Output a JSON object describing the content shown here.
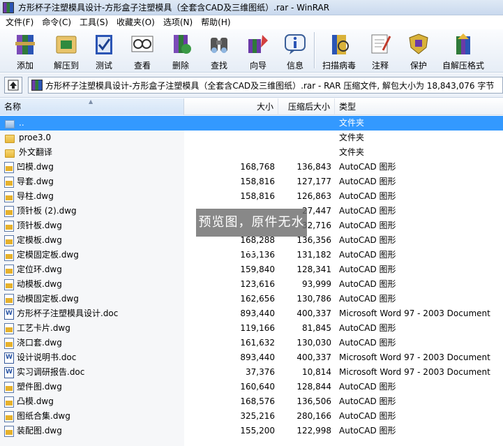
{
  "window": {
    "title": "方形杯子注塑模具设计-方形盒子注塑模具（全套含CAD及三维图纸）.rar - WinRAR"
  },
  "menu": [
    "文件(F)",
    "命令(C)",
    "工具(S)",
    "收藏夹(O)",
    "选项(N)",
    "帮助(H)"
  ],
  "toolbar": [
    {
      "label": "添加",
      "icon": "add-archive-icon"
    },
    {
      "label": "解压到",
      "icon": "extract-to-icon"
    },
    {
      "label": "测试",
      "icon": "test-icon"
    },
    {
      "label": "查看",
      "icon": "view-icon"
    },
    {
      "label": "删除",
      "icon": "delete-icon"
    },
    {
      "label": "查找",
      "icon": "find-icon"
    },
    {
      "label": "向导",
      "icon": "wizard-icon"
    },
    {
      "label": "信息",
      "icon": "info-icon"
    },
    {
      "label": "扫描病毒",
      "icon": "virus-scan-icon"
    },
    {
      "label": "注释",
      "icon": "comment-icon"
    },
    {
      "label": "保护",
      "icon": "protect-icon"
    },
    {
      "label": "自解压格式",
      "icon": "sfx-icon"
    }
  ],
  "address": {
    "path": "方形杯子注塑模具设计-方形盒子注塑模具（全套含CAD及三维图纸）.rar - RAR 压缩文件, 解包大小为 18,843,076 字节"
  },
  "columns": {
    "name": "名称",
    "size": "大小",
    "packed": "压缩后大小",
    "type": "类型"
  },
  "files": [
    {
      "name": "..",
      "size": "",
      "packed": "",
      "type": "文件夹",
      "kind": "folder-up",
      "selected": true
    },
    {
      "name": "proe3.0",
      "size": "",
      "packed": "",
      "type": "文件夹",
      "kind": "folder"
    },
    {
      "name": "外文翻译",
      "size": "",
      "packed": "",
      "type": "文件夹",
      "kind": "folder"
    },
    {
      "name": "凹模.dwg",
      "size": "168,768",
      "packed": "136,843",
      "type": "AutoCAD 图形",
      "kind": "dwg"
    },
    {
      "name": "导套.dwg",
      "size": "158,816",
      "packed": "127,177",
      "type": "AutoCAD 图形",
      "kind": "dwg"
    },
    {
      "name": "导柱.dwg",
      "size": "158,816",
      "packed": "126,863",
      "type": "AutoCAD 图形",
      "kind": "dwg"
    },
    {
      "name": "顶针板 (2).dwg",
      "size": "",
      "packed": "27,447",
      "type": "AutoCAD 图形",
      "kind": "dwg"
    },
    {
      "name": "顶针板.dwg",
      "size": "",
      "packed": "32,716",
      "type": "AutoCAD 图形",
      "kind": "dwg"
    },
    {
      "name": "定模板.dwg",
      "size": "168,288",
      "packed": "136,356",
      "type": "AutoCAD 图形",
      "kind": "dwg"
    },
    {
      "name": "定模固定板.dwg",
      "size": "163,136",
      "packed": "131,182",
      "type": "AutoCAD 图形",
      "kind": "dwg"
    },
    {
      "name": "定位环.dwg",
      "size": "159,840",
      "packed": "128,341",
      "type": "AutoCAD 图形",
      "kind": "dwg"
    },
    {
      "name": "动模板.dwg",
      "size": "123,616",
      "packed": "93,999",
      "type": "AutoCAD 图形",
      "kind": "dwg"
    },
    {
      "name": "动模固定板.dwg",
      "size": "162,656",
      "packed": "130,786",
      "type": "AutoCAD 图形",
      "kind": "dwg"
    },
    {
      "name": "方形杯子注塑模具设计.doc",
      "size": "893,440",
      "packed": "400,337",
      "type": "Microsoft Word 97 - 2003 Document",
      "kind": "doc"
    },
    {
      "name": "工艺卡片.dwg",
      "size": "119,166",
      "packed": "81,845",
      "type": "AutoCAD 图形",
      "kind": "dwg"
    },
    {
      "name": "浇口套.dwg",
      "size": "161,632",
      "packed": "130,030",
      "type": "AutoCAD 图形",
      "kind": "dwg"
    },
    {
      "name": "设计说明书.doc",
      "size": "893,440",
      "packed": "400,337",
      "type": "Microsoft Word 97 - 2003 Document",
      "kind": "doc"
    },
    {
      "name": "实习调研报告.doc",
      "size": "37,376",
      "packed": "10,814",
      "type": "Microsoft Word 97 - 2003 Document",
      "kind": "doc"
    },
    {
      "name": "塑件图.dwg",
      "size": "160,640",
      "packed": "128,844",
      "type": "AutoCAD 图形",
      "kind": "dwg"
    },
    {
      "name": "凸模.dwg",
      "size": "168,576",
      "packed": "136,506",
      "type": "AutoCAD 图形",
      "kind": "dwg"
    },
    {
      "name": "图纸合集.dwg",
      "size": "325,216",
      "packed": "280,166",
      "type": "AutoCAD 图形",
      "kind": "dwg"
    },
    {
      "name": "装配图.dwg",
      "size": "155,200",
      "packed": "122,998",
      "type": "AutoCAD 图形",
      "kind": "dwg"
    }
  ],
  "watermark": "预览图，原件无水印"
}
